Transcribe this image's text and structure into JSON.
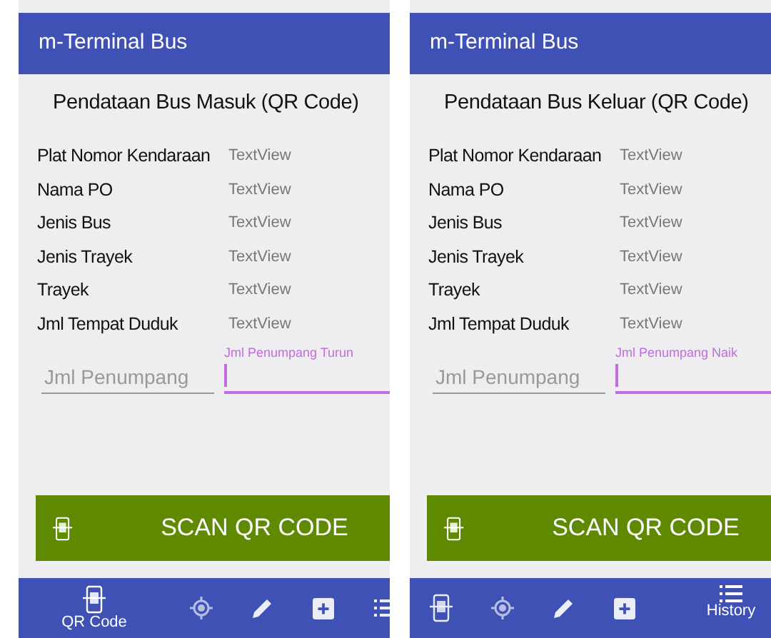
{
  "screens": [
    {
      "title": "m-Terminal Bus",
      "heading": "Pendataan Bus Masuk (QR Code)",
      "rows": [
        {
          "label": "Plat Nomor Kendaraan",
          "value": "TextView"
        },
        {
          "label": "Nama PO",
          "value": "TextView"
        },
        {
          "label": "Jenis Bus",
          "value": "TextView"
        },
        {
          "label": "Jenis Trayek",
          "value": "TextView"
        },
        {
          "label": "Trayek",
          "value": "TextView"
        },
        {
          "label": "Jml Tempat Duduk",
          "value": "TextView"
        }
      ],
      "field": {
        "placeholder": "Jml Penumpang"
      },
      "focused_field": {
        "label": "Jml Penumpang Turun"
      },
      "scan_button": {
        "label": "SCAN QR CODE"
      },
      "nav": [
        {
          "kind": "qr",
          "label": "QR Code",
          "selected": true
        },
        {
          "kind": "location",
          "selected": false
        },
        {
          "kind": "edit",
          "selected": false
        },
        {
          "kind": "add",
          "selected": false
        },
        {
          "kind": "history",
          "selected": false
        }
      ]
    },
    {
      "title": "m-Terminal Bus",
      "heading": "Pendataan Bus Keluar (QR Code)",
      "rows": [
        {
          "label": "Plat Nomor Kendaraan",
          "value": "TextView"
        },
        {
          "label": "Nama PO",
          "value": "TextView"
        },
        {
          "label": "Jenis Bus",
          "value": "TextView"
        },
        {
          "label": "Jenis Trayek",
          "value": "TextView"
        },
        {
          "label": "Trayek",
          "value": "TextView"
        },
        {
          "label": "Jml Tempat Duduk",
          "value": "TextView"
        }
      ],
      "field": {
        "placeholder": "Jml Penumpang"
      },
      "focused_field": {
        "label": "Jml Penumpang Naik"
      },
      "scan_button": {
        "label": "SCAN QR CODE"
      },
      "nav": [
        {
          "kind": "qr",
          "selected": false
        },
        {
          "kind": "location",
          "selected": false
        },
        {
          "kind": "edit",
          "selected": false
        },
        {
          "kind": "add",
          "selected": false
        },
        {
          "kind": "history",
          "label": "History",
          "selected": true
        }
      ]
    }
  ]
}
